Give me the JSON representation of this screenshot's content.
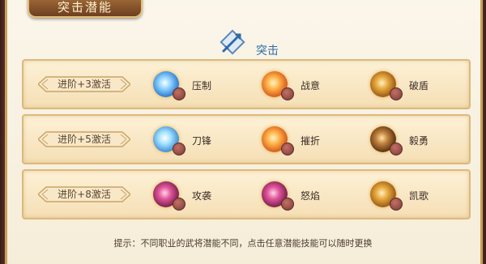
{
  "panel": {
    "title": "突击潜能"
  },
  "header": {
    "category_label": "突击",
    "category_icon": "spear-crest-icon"
  },
  "rows": [
    {
      "badge": "进阶+3激活",
      "skills": [
        {
          "name": "压制",
          "icon": "shield-icon"
        },
        {
          "name": "战意",
          "icon": "sword-flame-icon"
        },
        {
          "name": "破盾",
          "icon": "axe-burst-icon"
        }
      ]
    },
    {
      "badge": "进阶+5激活",
      "skills": [
        {
          "name": "刀锋",
          "icon": "blade-icon"
        },
        {
          "name": "摧折",
          "icon": "break-burst-icon"
        },
        {
          "name": "毅勇",
          "icon": "warrior-icon"
        }
      ]
    },
    {
      "badge": "进阶+8激活",
      "skills": [
        {
          "name": "攻袭",
          "icon": "charge-icon"
        },
        {
          "name": "怒焰",
          "icon": "rage-flame-icon"
        },
        {
          "name": "凯歌",
          "icon": "triumph-icon"
        }
      ]
    }
  ],
  "hint": "提示：不同职业的武将潜能不同，点击任意潜能技能可以随时更换",
  "colors": {
    "accent": "#2e6aa8",
    "panel_bg": "#fdf1d6",
    "border": "#dcb97a"
  }
}
